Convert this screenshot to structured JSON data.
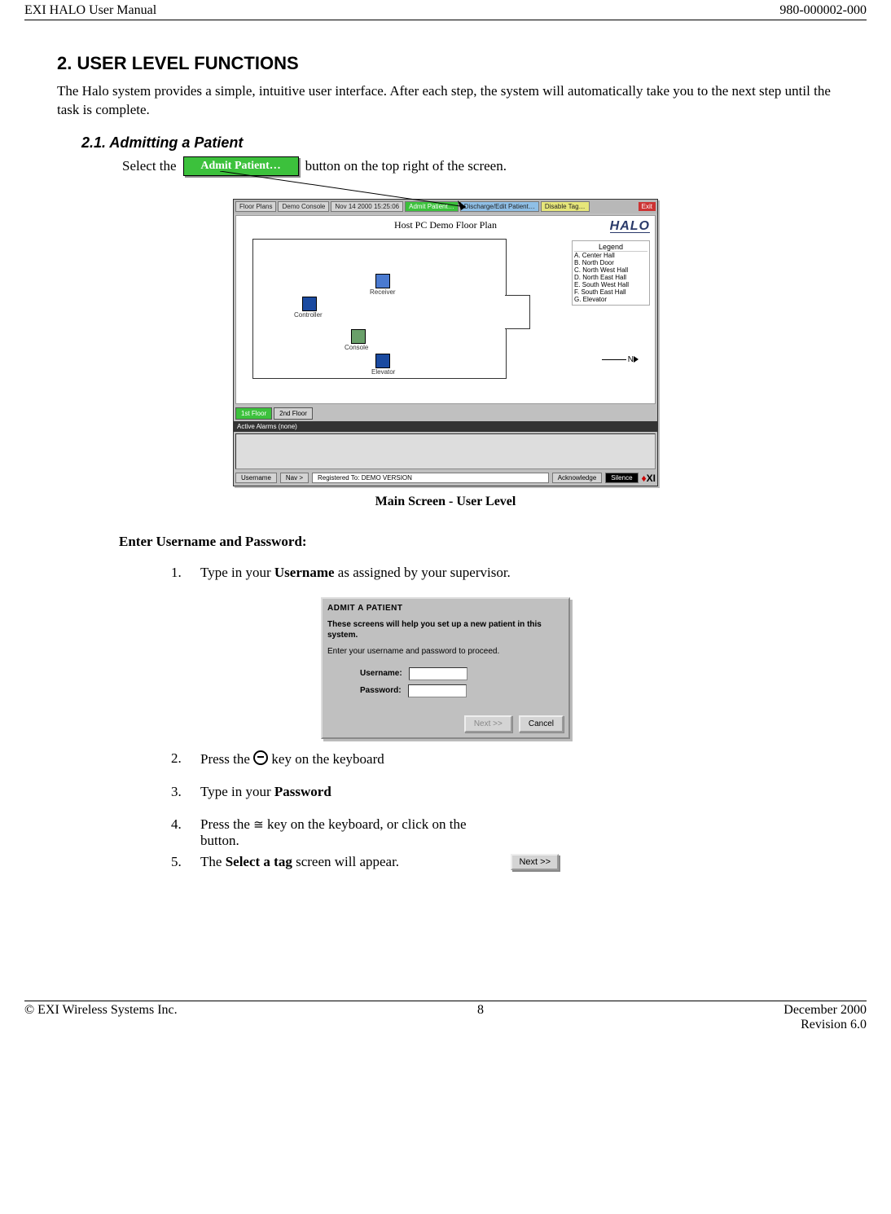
{
  "header": {
    "left": "EXI HALO User Manual",
    "right": "980-000002-000"
  },
  "sections": {
    "h2": "2.   USER LEVEL FUNCTIONS",
    "intro": "The Halo system provides a simple, intuitive user interface.  After each step, the system will automatically take you to the next step until the task is complete.",
    "h3": "2.1.   Admitting a Patient",
    "select_pre": "Select the",
    "select_btn": "Admit Patient…",
    "select_post": "button on the top right of the screen.",
    "caption1": "Main Screen - User Level",
    "subhead": "Enter Username and Password:",
    "steps": {
      "s1_pre": "Type in your ",
      "s1_b": "Username",
      "s1_post": " as assigned by your supervisor.",
      "s2": "Press the ",
      "s2_post": " key on the keyboard",
      "s3_pre": "Type in your ",
      "s3_b": "Password",
      "s4_pre": "Press the  ",
      "s4_mid": "key on the keyboard, or click on the",
      "s4_post": "button.",
      "s5_pre": "The ",
      "s5_b": "Select a tag",
      "s5_post": " screen will appear."
    }
  },
  "app": {
    "topbar": {
      "floor": "Floor Plans",
      "console": "Demo Console",
      "date": "Nov 14 2000  15:25:06",
      "admit": "Admit Patient…",
      "discharge": "Discharge/Edit Patient…",
      "disable": "Disable Tag…",
      "exit": "Exit"
    },
    "plan_title": "Host PC Demo Floor Plan",
    "logo": "HALO",
    "icons": {
      "receiver": "Receiver",
      "controller": "Controller",
      "console": "Console",
      "elevator": "Elevator"
    },
    "legend_title": "Legend",
    "legend_items": [
      "A.    Center Hall",
      "B.    North Door",
      "C.    North West Hall",
      "D.    North East Hall",
      "E.    South West Hall",
      "F.    South East Hall",
      "G.    Elevator"
    ],
    "north": "N",
    "tabs": {
      "t1": "1st Floor",
      "t2": "2nd Floor"
    },
    "alarms": "Active Alarms (none)",
    "status": {
      "user": "Username",
      "nav": "Nav >",
      "reg": "Registered To:  DEMO VERSION",
      "ack": "Acknowledge",
      "sil": "Silence"
    },
    "xilogo": "XI"
  },
  "dialog": {
    "title": "ADMIT A PATIENT",
    "sub": "These screens will help you set up a new patient in this system.",
    "prompt": "Enter your username and password to proceed.",
    "user_lbl": "Username:",
    "pass_lbl": "Password:",
    "next": "Next >>",
    "cancel": "Cancel"
  },
  "nextbtn": "Next >>",
  "footer": {
    "left": "©  EXI Wireless Systems Inc.",
    "center": "8",
    "right1": "December 2000",
    "right2": "Revision 6.0"
  }
}
